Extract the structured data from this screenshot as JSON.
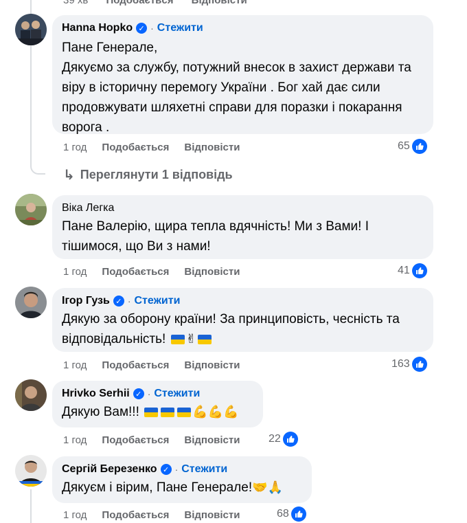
{
  "top_strip": {
    "time": "39 хв",
    "like": "Подобається",
    "reply": "Відповісти"
  },
  "comments": [
    {
      "author": "Hanna Hopko",
      "verified": true,
      "follow": "Стежити",
      "text": "Пане Генерале,\nДякуємо за службу, потужний внесок в захист держави та віру в історичну перемогу України . Бог хай дає сили продовжувати шляхетні справи для поразки і покарання ворога .",
      "time": "1 год",
      "like": "Подобається",
      "reply": "Відповісти",
      "likes": "65"
    },
    {
      "author": "Віка Легка",
      "verified": false,
      "text": "Пане Валерію, щира тепла вдячність! Ми з Вами! І тішимося, що Ви з нами!",
      "time": "1 год",
      "like": "Подобається",
      "reply": "Відповісти",
      "likes": "41"
    },
    {
      "author": "Ігор Гузь",
      "verified": true,
      "follow": "Стежити",
      "text": "Дякую за оборону країни! За принциповість, чесність та відповідальність!",
      "time": "1 год",
      "like": "Подобається",
      "reply": "Відповісти",
      "likes": "163"
    },
    {
      "author": "Hrivko Serhii",
      "verified": true,
      "follow": "Стежити",
      "text": "Дякую Вам!!!",
      "time": "1 год",
      "like": "Подобається",
      "reply": "Відповісти",
      "likes": "22"
    },
    {
      "author": "Сергій Березенко",
      "verified": true,
      "follow": "Стежити",
      "text": "Дякуєм і вірим, Пане Генерале!",
      "time": "1 год",
      "like": "Подобається",
      "reply": "Відповісти",
      "likes": "68"
    }
  ],
  "view_replies": "Переглянути 1 відповідь",
  "icons": {
    "like": "thumbs-up-icon",
    "verified": "verified-badge-icon",
    "reply_arrow": "reply-arrow-icon"
  },
  "colors": {
    "accent": "#0866ff",
    "follow": "#0064d1",
    "bubble": "#f0f2f5",
    "muted": "#65676b"
  }
}
